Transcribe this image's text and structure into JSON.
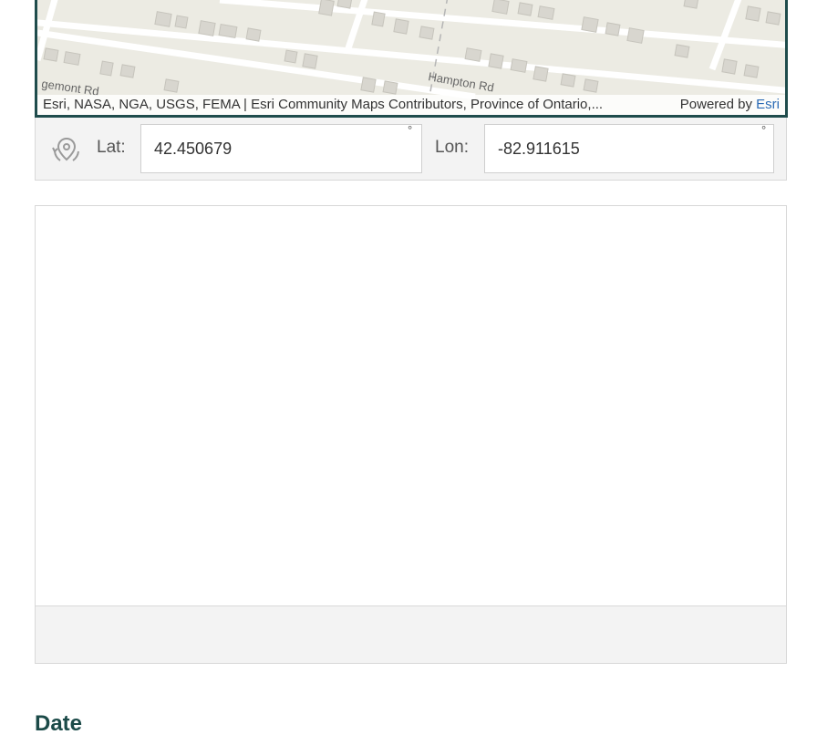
{
  "map": {
    "street_labels": [
      "gemont Rd",
      "Hampton Rd"
    ],
    "attribution": "Esri, NASA, NGA, USGS, FEMA | Esri Community Maps Contributors, Province of Ontario,...",
    "powered_by": "Powered by",
    "esri_link": "Esri",
    "colors": {
      "frame": "#1f4c4c",
      "land": "#ecebe3",
      "road": "#ffffff",
      "building": "#d8d6cf"
    }
  },
  "coordinates": {
    "icon": "locate-pin-icon",
    "lat_label": "Lat:",
    "lat_value": "42.450679",
    "lon_label": "Lon:",
    "lon_value": "-82.911615",
    "degree_symbol": "°"
  },
  "section": {
    "title": "Date",
    "title_color": "#1b4a48"
  }
}
